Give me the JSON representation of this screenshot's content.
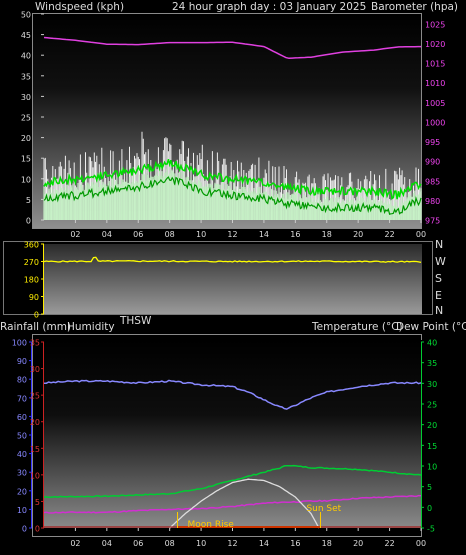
{
  "header": {
    "wind_label": "Windspeed (kph)",
    "title": "24 hour graph day : 03 January 2025",
    "baro_label": "Barometer (hpa)"
  },
  "direction_panel": {
    "compass": [
      "N",
      "W",
      "S",
      "E",
      "N"
    ],
    "thsw_label": "THSW"
  },
  "bottom_header": {
    "rain_label": "Rainfall (mm)",
    "humidity_label": "Humidity",
    "temp_label": "Temperature (°C)",
    "dew_label": "Dew Point (°C)"
  },
  "annotations": {
    "moon_rise": "Moon Rise",
    "sun_set": "Sun Set"
  },
  "colors": {
    "wind_gust": "#ffffff",
    "wind_avg": "#00dd00",
    "barometer": "#e040e0",
    "direction": "#ffff00",
    "humidity": "#8888ff",
    "temperature": "#00cc33",
    "dew_point": "#d030d0",
    "solar": "#dddddd",
    "rain_axis": "#cc2222",
    "annotation": "#ffcc00"
  },
  "chart_data": [
    {
      "type": "line",
      "name": "wind-barometer",
      "x_ticks": [
        "02",
        "04",
        "06",
        "08",
        "10",
        "12",
        "14",
        "16",
        "18",
        "20",
        "22",
        "00"
      ],
      "y_left_ticks": [
        "0",
        "5",
        "10",
        "15",
        "20",
        "25",
        "30",
        "35",
        "40",
        "45",
        "50"
      ],
      "y_left_range": [
        0,
        50
      ],
      "y_right_ticks": [
        "975",
        "980",
        "985",
        "990",
        "995",
        "1000",
        "1005",
        "1010",
        "1015",
        "1020",
        "1025"
      ],
      "y_right_range": [
        975,
        1027.5
      ],
      "x": [
        0,
        2,
        4,
        6,
        8,
        10,
        12,
        14,
        15.5,
        17,
        19,
        21,
        22.5,
        24
      ],
      "series": [
        {
          "name": "Barometer (hpa)",
          "axis": "right",
          "values": [
            1021.5,
            1020.8,
            1019.8,
            1019.7,
            1020.2,
            1020.2,
            1020.3,
            1019.2,
            1016.2,
            1016.5,
            1017.8,
            1018.3,
            1019.1,
            1019.2
          ]
        },
        {
          "name": "Average wind",
          "axis": "left",
          "values": [
            9,
            10,
            11,
            12,
            14,
            11,
            10,
            9,
            8,
            7,
            7,
            7,
            6,
            9
          ]
        },
        {
          "name": "Gust",
          "axis": "left",
          "values": [
            18,
            18,
            20,
            25,
            22,
            21,
            19,
            17,
            15,
            13,
            14,
            14,
            15,
            16
          ]
        }
      ]
    },
    {
      "type": "line",
      "name": "wind-direction",
      "y_ticks": [
        "0",
        "90",
        "180",
        "270",
        "360"
      ],
      "y_range": [
        0,
        360
      ],
      "x": [
        0,
        6,
        12,
        18,
        24
      ],
      "series": [
        {
          "name": "Direction",
          "values": [
            270,
            272,
            270,
            271,
            268
          ]
        }
      ]
    },
    {
      "type": "line",
      "name": "temperature-humidity",
      "x_ticks": [
        "02",
        "04",
        "06",
        "08",
        "10",
        "12",
        "14",
        "16",
        "18",
        "20",
        "22",
        "00"
      ],
      "humidity_ticks": [
        "0",
        "10",
        "20",
        "30",
        "40",
        "50",
        "60",
        "70",
        "80",
        "90",
        "100"
      ],
      "humidity_range": [
        0,
        100
      ],
      "rain_ticks": [
        "0",
        "5",
        "10",
        "15",
        "20",
        "25",
        "30",
        "35"
      ],
      "rain_range": [
        0,
        35
      ],
      "temp_ticks": [
        "-5",
        "0",
        "5",
        "10",
        "15",
        "20",
        "25",
        "30",
        "35",
        "40"
      ],
      "temp_range": [
        -5,
        40
      ],
      "x": [
        0,
        2,
        4,
        6,
        8,
        10,
        12,
        13,
        14,
        15,
        15.5,
        16,
        17,
        18,
        20,
        22,
        24
      ],
      "series": [
        {
          "name": "Humidity",
          "axis": "humidity",
          "values": [
            78,
            79,
            79,
            78,
            79,
            77,
            76,
            73,
            69,
            65,
            64,
            66,
            70,
            73,
            76,
            78,
            78
          ]
        },
        {
          "name": "Temperature",
          "axis": "temp",
          "values": [
            2.5,
            2.6,
            2.7,
            3,
            3.3,
            4.5,
            6.5,
            7.5,
            8.5,
            9.5,
            10.2,
            10,
            9.6,
            9.5,
            9.2,
            8.5,
            7.8
          ]
        },
        {
          "name": "Dew Point",
          "axis": "temp",
          "values": [
            -1.3,
            -1.2,
            -1.2,
            -0.8,
            -0.5,
            -0.3,
            0.2,
            0.6,
            1,
            1.2,
            1.3,
            1.3,
            1.5,
            1.6,
            2.2,
            2.5,
            2.8
          ]
        },
        {
          "name": "Solar",
          "axis": "temp",
          "x": [
            8,
            9,
            10,
            11,
            12,
            13,
            14,
            15,
            16,
            17,
            17.5
          ],
          "values": [
            -5,
            -1.5,
            1.5,
            4,
            6,
            6.8,
            6.5,
            5,
            2.5,
            -1.5,
            -5
          ]
        },
        {
          "name": "Rainfall",
          "axis": "rain",
          "values": [
            0,
            0,
            0,
            0,
            0,
            0,
            0,
            0,
            0,
            0,
            0,
            0,
            0,
            0,
            0,
            0,
            0
          ]
        }
      ],
      "markers": [
        {
          "label": "Moon Rise",
          "x": 8.5
        },
        {
          "label": "Sun Set",
          "x": 17.6
        }
      ]
    }
  ]
}
